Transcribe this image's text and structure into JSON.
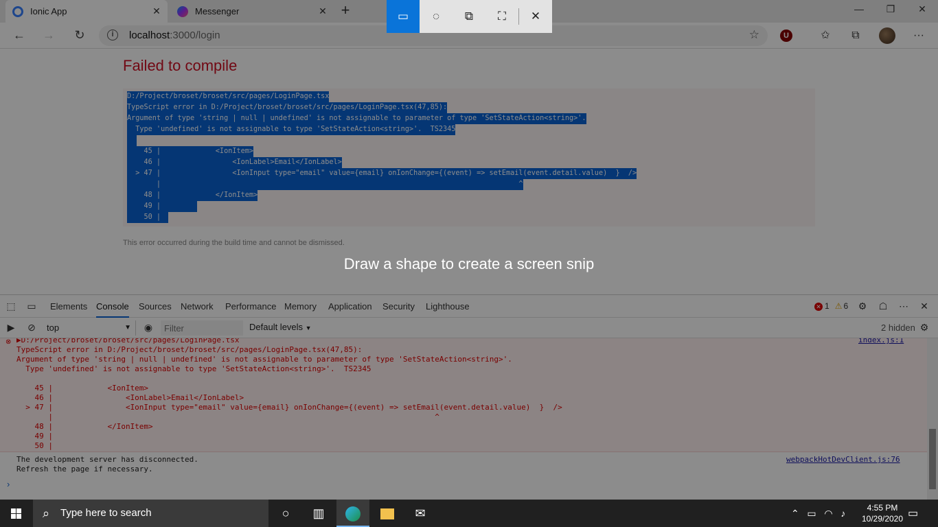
{
  "browser": {
    "tabs": [
      {
        "label": "Ionic App",
        "favicon": "ionic-icon",
        "active": true
      },
      {
        "label": "Messenger",
        "favicon": "messenger-icon",
        "active": false
      }
    ],
    "url": {
      "host": "localhost",
      "path": ":3000/login"
    },
    "accent": "#0a63d4"
  },
  "page": {
    "title": "Failed to compile",
    "code_lines": [
      "D:/Project/broset/broset/src/pages/LoginPage.tsx",
      "TypeScript error in D:/Project/broset/broset/src/pages/LoginPage.tsx(47,85):",
      "Argument of type 'string | null | undefined' is not assignable to parameter of type 'SetStateAction<string>'.",
      "  Type 'undefined' is not assignable to type 'SetStateAction<string>'.  TS2345",
      " ",
      "    45 |             <IonItem>",
      "    46 |                 <IonLabel>Email</IonLabel>",
      "  > 47 |                 <IonInput type=\"email\" value={email} onIonChange={(event) => setEmail(event.detail.value)  }  />",
      "       |                                                                                     ^",
      "    48 |             </IonItem>",
      "    49 |",
      "    50 |"
    ],
    "note": "This error occurred during the build time and cannot be dismissed."
  },
  "snip": {
    "hint": "Draw a shape to create a screen snip",
    "buttons": [
      {
        "name": "rectangular-snip",
        "icon": "▭",
        "active": true
      },
      {
        "name": "freeform-snip",
        "icon": "◌",
        "active": false
      },
      {
        "name": "window-snip",
        "icon": "⧉",
        "active": false
      },
      {
        "name": "fullscreen-snip",
        "icon": "⛶",
        "active": false
      }
    ],
    "close": "✕"
  },
  "devtools": {
    "tabs": [
      "Elements",
      "Console",
      "Sources",
      "Network",
      "Performance",
      "Memory",
      "Application",
      "Security",
      "Lighthouse"
    ],
    "active_tab": "Console",
    "error_count": "1",
    "warning_count": "6",
    "context": "top",
    "filter_placeholder": "Filter",
    "levels": "Default levels",
    "hidden": "2 hidden",
    "log_lines": [
      "▶D:/Project/broset/broset/src/pages/LoginPage.tsx",
      "TypeScript error in D:/Project/broset/broset/src/pages/LoginPage.tsx(47,85):",
      "Argument of type 'string | null | undefined' is not assignable to parameter of type 'SetStateAction<string>'.",
      "  Type 'undefined' is not assignable to type 'SetStateAction<string>'.  TS2345",
      "",
      "    45 |            <IonItem>",
      "    46 |                <IonLabel>Email</IonLabel>",
      "  > 47 |                <IonInput type=\"email\" value={email} onIonChange={(event) => setEmail(event.detail.value)  }  />",
      "       |                                                                                    ^",
      "    48 |            </IonItem>",
      "    49 |",
      "    50 |"
    ],
    "error_source": "index.js:1",
    "messages": [
      "The development server has disconnected.",
      "Refresh the page if necessary."
    ],
    "message_source": "webpackHotDevClient.js:76"
  },
  "taskbar": {
    "search_placeholder": "Type here to search",
    "time": "4:55 PM",
    "date": "10/29/2020"
  }
}
